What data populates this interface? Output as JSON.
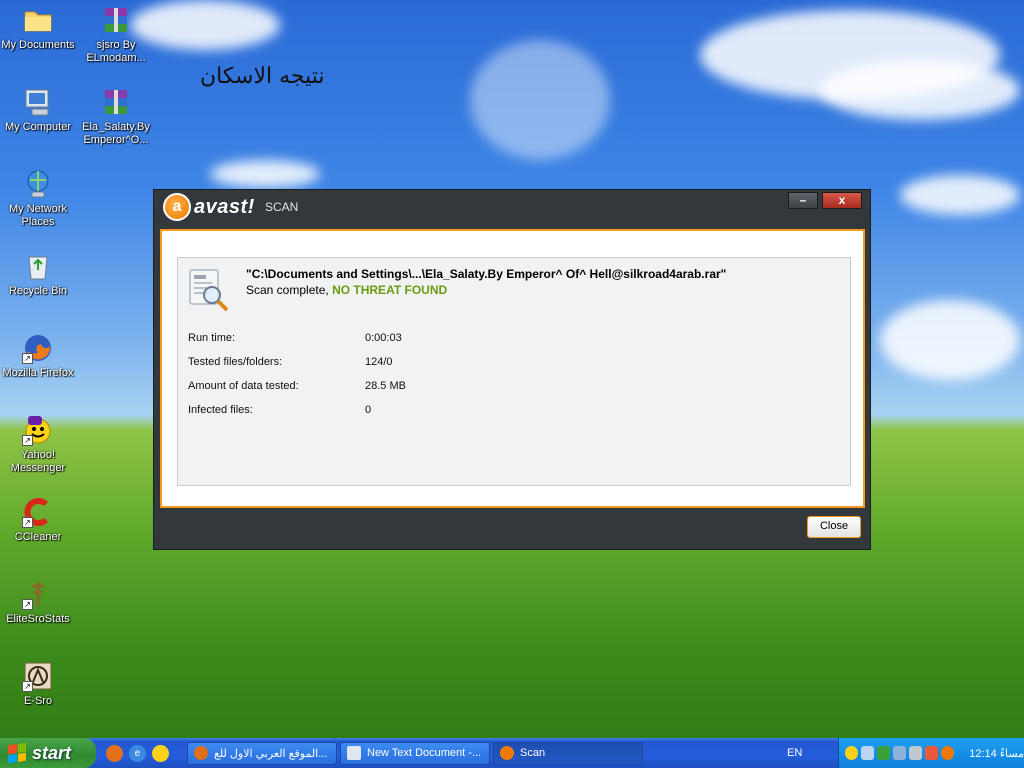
{
  "desktop": {
    "icons": [
      {
        "label": "My Documents",
        "icon": "folder-icon"
      },
      {
        "label": "sjsro By ELmodam...",
        "icon": "winrar-archive-icon"
      },
      {
        "label": "My Computer",
        "icon": "computer-icon"
      },
      {
        "label": "Ela_Salaty.By Emperor^O...",
        "icon": "winrar-archive-icon"
      },
      {
        "label": "My Network Places",
        "icon": "network-icon"
      },
      {
        "label": "Recycle Bin",
        "icon": "recycle-bin-icon"
      },
      {
        "label": "Mozilla Firefox",
        "icon": "firefox-icon"
      },
      {
        "label": "Yahoo! Messenger",
        "icon": "yahoo-messenger-icon"
      },
      {
        "label": "CCleaner",
        "icon": "ccleaner-icon"
      },
      {
        "label": "EliteSroStats",
        "icon": "stats-icon"
      },
      {
        "label": "E-Sro",
        "icon": "esro-icon"
      }
    ],
    "arabic_text": "نتيجه الاسكان"
  },
  "avast": {
    "brand": "avast!",
    "window_label": "SCAN",
    "minimize": "–",
    "close_x": "x",
    "scan_path": "\"C:\\Documents and Settings\\...\\Ela_Salaty.By Emperor^ Of^ Hell@silkroad4arab.rar\"",
    "status_prefix": "Scan complete,",
    "status_result": "NO THREAT FOUND",
    "stats": [
      {
        "label": "Run time:",
        "value": "0:00:03"
      },
      {
        "label": "Tested files/folders:",
        "value": "124/0"
      },
      {
        "label": "Amount of data tested:",
        "value": "28.5 MB"
      },
      {
        "label": "Infected files:",
        "value": "0"
      }
    ],
    "close_button": "Close"
  },
  "taskbar": {
    "start": "start",
    "quick_launch": [
      "firefox-icon",
      "ie-icon",
      "yahoo-messenger-icon"
    ],
    "tasks": [
      {
        "label": "الموقع العربي الاول للع...",
        "icon": "firefox-icon",
        "active": false
      },
      {
        "label": "New Text Document -...",
        "icon": "notepad-icon",
        "active": false
      },
      {
        "label": "Scan",
        "icon": "avast-icon",
        "active": true
      }
    ],
    "language": "EN",
    "clock": "12:14 مساءً"
  },
  "colors": {
    "avast_orange": "#f39a1d",
    "threat_green": "#6a9c10",
    "window_dark": "#33383c"
  }
}
